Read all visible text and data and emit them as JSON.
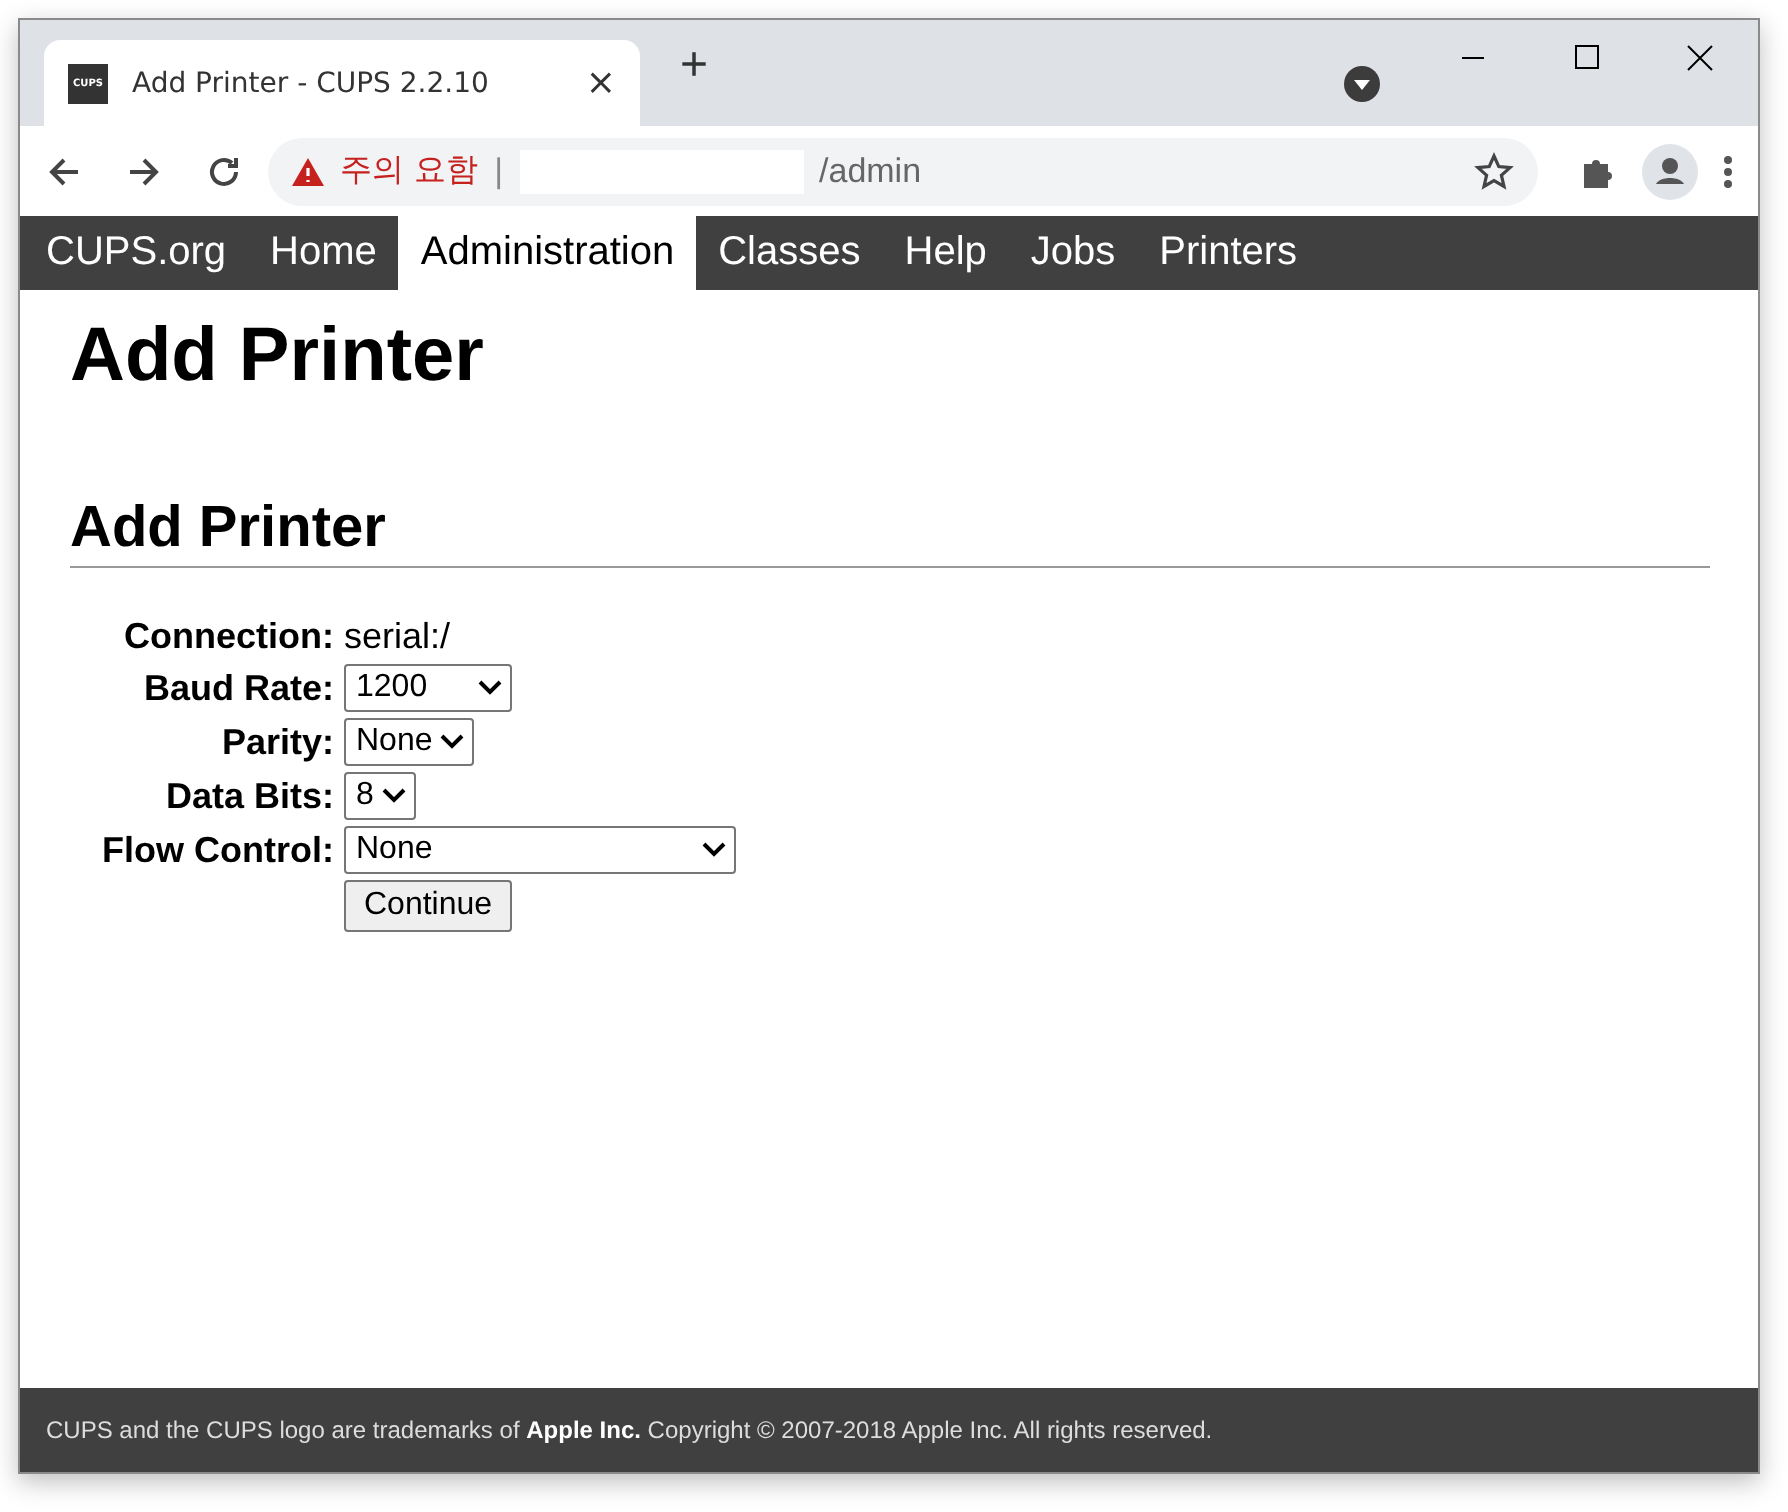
{
  "browser": {
    "tab": {
      "favicon_text": "CUPS",
      "title": "Add Printer - CUPS 2.2.10",
      "close": "×"
    },
    "new_tab": "+",
    "address": {
      "warning": "주의 요함",
      "separator": "|",
      "path": "/admin"
    }
  },
  "nav": [
    {
      "label": "CUPS.org",
      "selected": false
    },
    {
      "label": "Home",
      "selected": false
    },
    {
      "label": "Administration",
      "selected": true
    },
    {
      "label": "Classes",
      "selected": false
    },
    {
      "label": "Help",
      "selected": false
    },
    {
      "label": "Jobs",
      "selected": false
    },
    {
      "label": "Printers",
      "selected": false
    }
  ],
  "page_title": "Add Printer",
  "section_title": "Add Printer",
  "form": [
    {
      "kind": "text",
      "label": "Connection:",
      "value": "serial:/"
    },
    {
      "kind": "select",
      "label": "Baud Rate:",
      "value": "1200"
    },
    {
      "kind": "select",
      "label": "Parity:",
      "value": "None"
    },
    {
      "kind": "select",
      "label": "Data Bits:",
      "value": "8"
    },
    {
      "kind": "select",
      "label": "Flow Control:",
      "value": "None"
    }
  ],
  "continue_button": "Continue",
  "footer": "CUPS and the CUPS logo are trademarks of **Apple Inc.** Copyright © 2007-2018 Apple Inc. All rights reserved."
}
